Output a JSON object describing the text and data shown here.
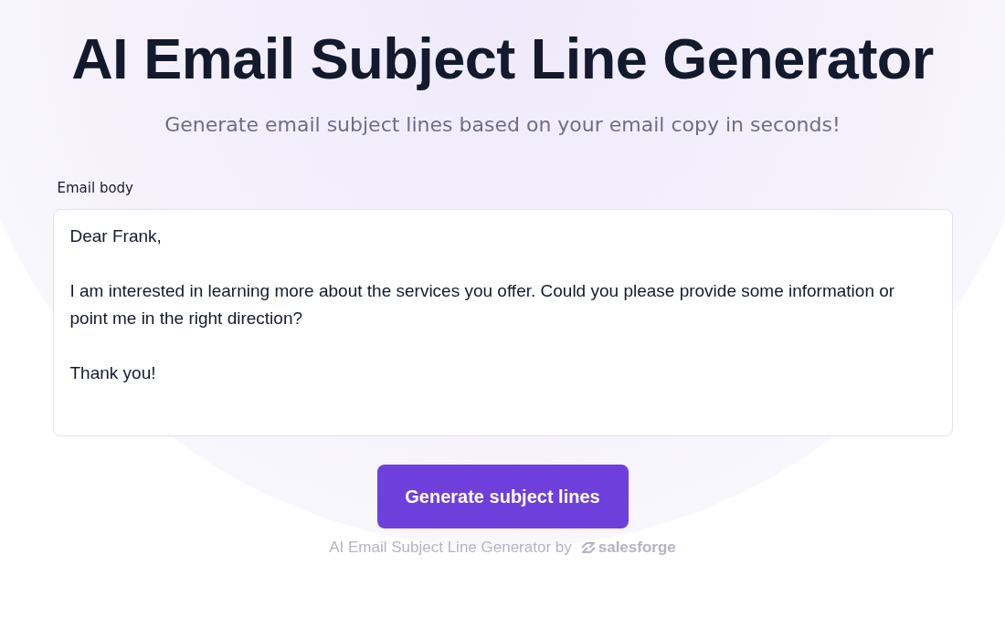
{
  "title": "AI Email Subject Line Generator",
  "subtitle": "Generate email subject lines based on your email copy in seconds!",
  "email_body": {
    "label": "Email body",
    "value": "Dear Frank,\n\nI am interested in learning more about the services you offer. Could you please provide some information or point me in the right direction?\n\nThank you!"
  },
  "button": "Generate subject lines",
  "footer": {
    "text": "AI Email Subject Line Generator by",
    "brand": "salesforge"
  }
}
